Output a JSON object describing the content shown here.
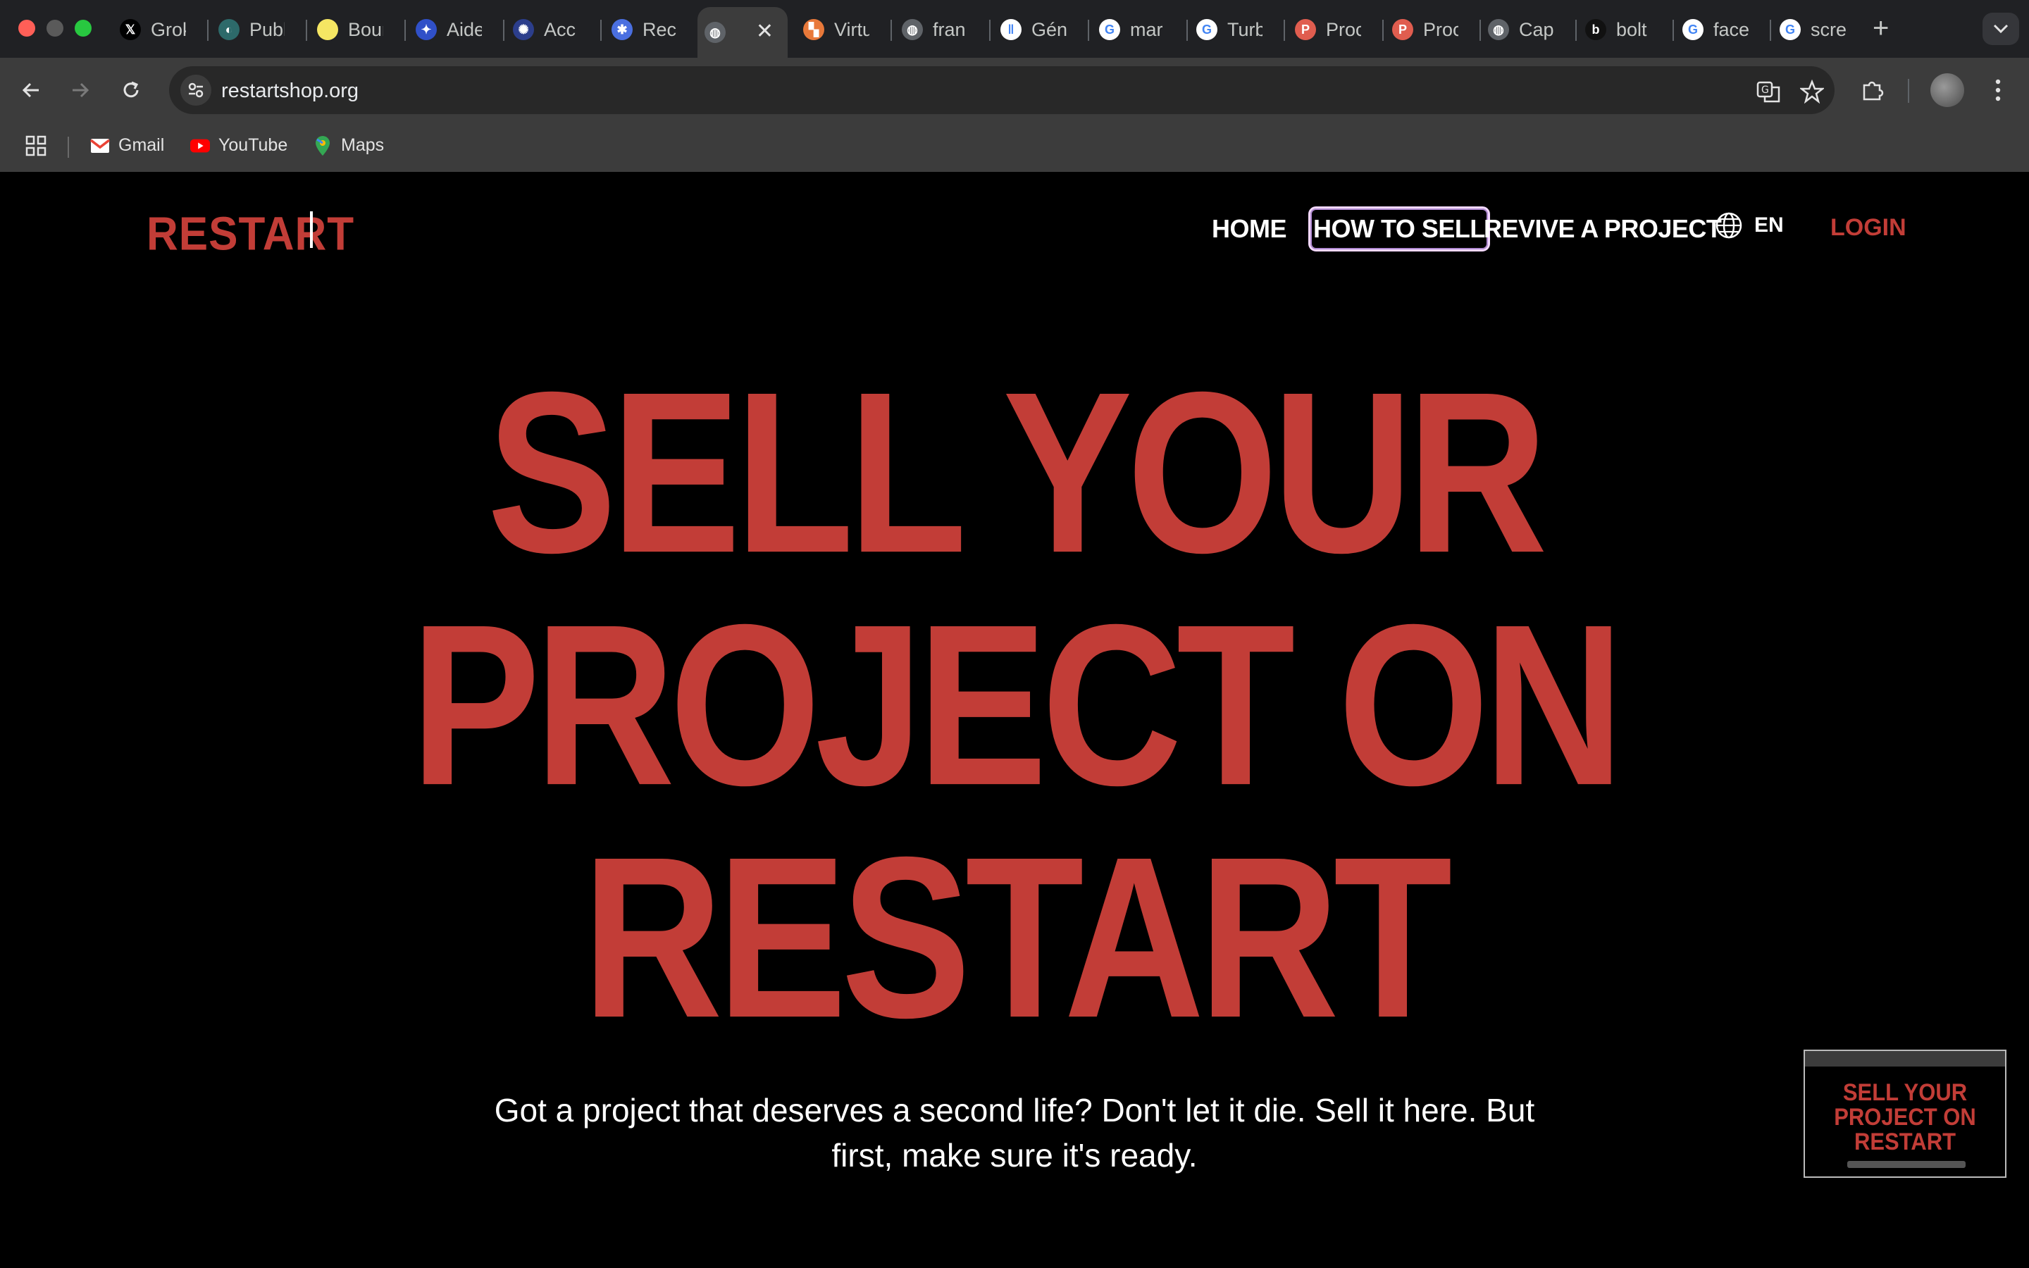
{
  "browser": {
    "tabs": [
      {
        "label": "Grok",
        "icon": "x-icon",
        "color": "#000000",
        "glyph": "𝕏"
      },
      {
        "label": "Publ",
        "icon": "publ-icon",
        "color": "#2d6a6a",
        "glyph": "◐"
      },
      {
        "label": "Boun",
        "icon": "bounce-icon",
        "color": "#f5e663",
        "glyph": ""
      },
      {
        "label": "Aide",
        "icon": "aide-icon",
        "color": "#3050c8",
        "glyph": "✦"
      },
      {
        "label": "Acc",
        "icon": "acc-icon",
        "color": "#2c3e8c",
        "glyph": "✺"
      },
      {
        "label": "Rec",
        "icon": "rec-icon",
        "color": "#4a6fe0",
        "glyph": "✱"
      },
      {
        "label": "",
        "icon": "globe-icon",
        "color": "#5f6368",
        "glyph": "◍",
        "active": true
      },
      {
        "label": "Virtu",
        "icon": "virtu-icon",
        "color": "#e8793a",
        "glyph": "▚"
      },
      {
        "label": "fran",
        "icon": "globe-icon",
        "color": "#5f6368",
        "glyph": "◍"
      },
      {
        "label": "Gén",
        "icon": "pause-icon",
        "color": "#ffffff",
        "glyph": "‖"
      },
      {
        "label": "mar",
        "icon": "google-icon",
        "color": "#ffffff",
        "glyph": "G"
      },
      {
        "label": "Turb",
        "icon": "google-icon",
        "color": "#ffffff",
        "glyph": "G"
      },
      {
        "label": "Proc",
        "icon": "p-icon",
        "color": "#e05d4f",
        "glyph": "P"
      },
      {
        "label": "Proc",
        "icon": "p-icon",
        "color": "#e05d4f",
        "glyph": "P"
      },
      {
        "label": "Cap",
        "icon": "globe-icon",
        "color": "#5f6368",
        "glyph": "◍"
      },
      {
        "label": "bolt",
        "icon": "bolt-icon",
        "color": "#111111",
        "glyph": "b"
      },
      {
        "label": "face",
        "icon": "google-icon",
        "color": "#ffffff",
        "glyph": "G"
      },
      {
        "label": "scre",
        "icon": "google-icon",
        "color": "#ffffff",
        "glyph": "G"
      }
    ],
    "url": "restartshop.org",
    "bookmarks": [
      {
        "label": "Gmail",
        "icon": "gmail-icon"
      },
      {
        "label": "YouTube",
        "icon": "youtube-icon"
      },
      {
        "label": "Maps",
        "icon": "maps-icon"
      }
    ]
  },
  "site": {
    "logo": "RESTART",
    "nav": {
      "home": "HOME",
      "how_to_sell": "HOW TO SELL",
      "revive": "REVIVE A PROJECT",
      "lang": "EN",
      "login": "LOGIN"
    },
    "hero": {
      "line1": "SELL YOUR",
      "line2": "PROJECT ON",
      "line3": "RESTART",
      "subtitle": "Got a project that deserves a second life? Don't let it die. Sell it here. But first, make sure it's ready."
    },
    "thumbnail": {
      "title_lines": [
        "SELL YOUR",
        "PROJECT ON",
        "RESTART"
      ]
    },
    "colors": {
      "accent": "#c23d37",
      "background": "#000000",
      "text": "#ffffff"
    }
  }
}
